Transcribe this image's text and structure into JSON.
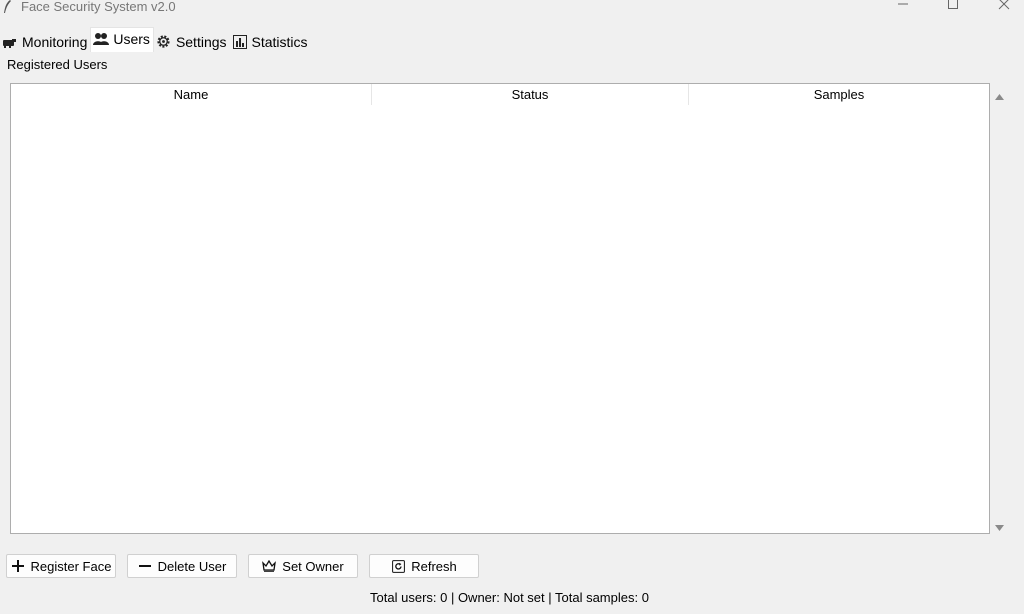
{
  "window": {
    "title": "Face Security System v2.0",
    "controls": [
      "minimize-icon",
      "maximize-icon",
      "close-icon"
    ]
  },
  "tabs": [
    {
      "label": "Monitoring",
      "icon": "camera-icon",
      "active": false
    },
    {
      "label": "Users",
      "icon": "users-icon",
      "active": true
    },
    {
      "label": "Settings",
      "icon": "gear-icon",
      "active": false
    },
    {
      "label": "Statistics",
      "icon": "bar-chart-icon",
      "active": false
    }
  ],
  "users_panel": {
    "group_title": "Registered Users",
    "table": {
      "columns": [
        "Name",
        "Status",
        "Samples"
      ],
      "rows": []
    }
  },
  "buttons": {
    "register": {
      "label": "Register Face",
      "icon": "plus-icon"
    },
    "delete": {
      "label": "Delete User",
      "icon": "minus-icon"
    },
    "owner": {
      "label": "Set Owner",
      "icon": "crown-icon"
    },
    "refresh": {
      "label": "Refresh",
      "icon": "refresh-icon"
    }
  },
  "status": {
    "text": "Total users: 0 | Owner: Not set | Total samples: 0"
  }
}
